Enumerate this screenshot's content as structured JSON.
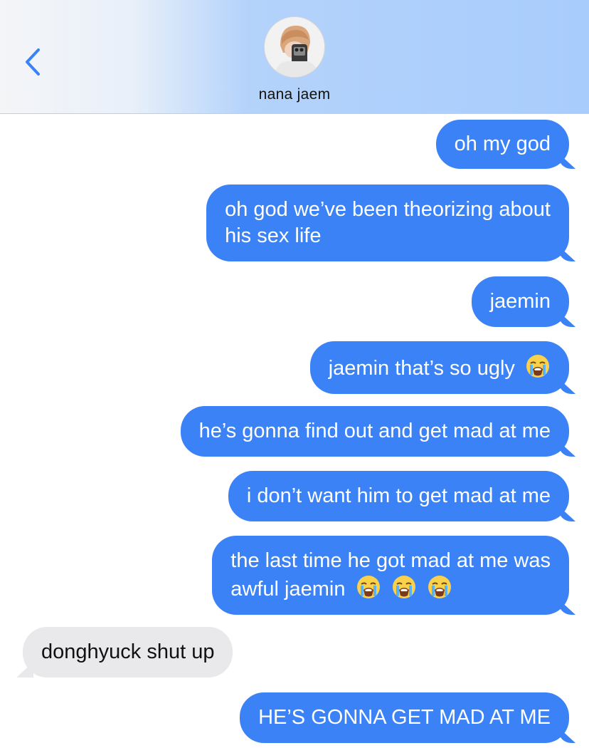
{
  "header": {
    "contact_name": "nana jaem"
  },
  "icons": {
    "back": "chevron-left-icon",
    "avatar": "contact-avatar",
    "emoji": "loudly-crying-face-emoji"
  },
  "colors": {
    "sent_bubble": "#3b82f6",
    "received_bubble": "#e9e9eb",
    "back_chevron": "#3b82f6"
  },
  "messages": [
    {
      "direction": "sent",
      "text": "oh my god"
    },
    {
      "direction": "sent",
      "line1": "oh god we’ve been theorizing about",
      "line2": "his sex life"
    },
    {
      "direction": "sent",
      "text": "jaemin"
    },
    {
      "direction": "sent",
      "text": "jaemin that’s so ugly",
      "emoji_count": 1
    },
    {
      "direction": "sent",
      "text": "he’s gonna find out and get mad at me"
    },
    {
      "direction": "sent",
      "text": "i don’t want him to get mad at me"
    },
    {
      "direction": "sent",
      "line1": "the last time he got mad at me was",
      "line2": "awful jaemin",
      "emoji_count": 3
    },
    {
      "direction": "received",
      "text": "donghyuck shut up"
    },
    {
      "direction": "sent",
      "text": "HE’S GONNA GET MAD AT ME"
    }
  ]
}
